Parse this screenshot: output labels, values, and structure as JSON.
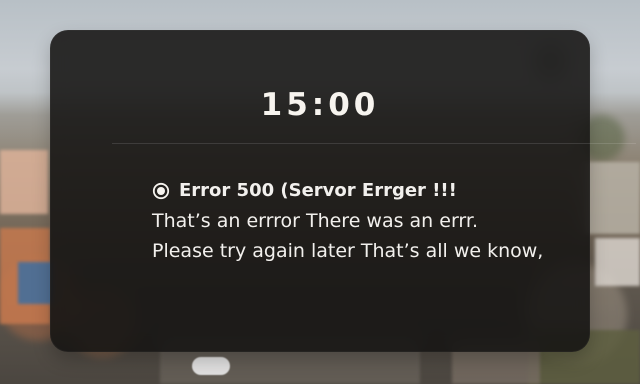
{
  "screen": {
    "time": "15:00"
  },
  "notification": {
    "icon": "record-icon",
    "title": "Error 500 (Servor  Errger !!!",
    "line1": "That’s an errror There was an errr.",
    "line2": "Please try again later That’s all we know,"
  },
  "colors": {
    "card_background": "#151312",
    "text_primary": "#f7f4ef",
    "divider": "#ffffff"
  }
}
